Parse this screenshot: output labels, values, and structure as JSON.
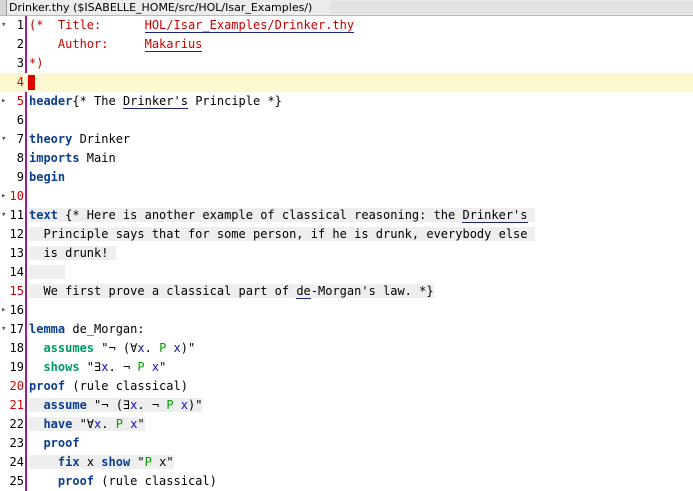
{
  "window": {
    "title": "Drinker.thy ($ISABELLE_HOME/src/HOL/Isar_Examples/)"
  },
  "editor": {
    "lines": [
      {
        "n": "1",
        "fold": "▾",
        "gutter_color": "black",
        "segs": [
          [
            "cm",
            "(*  Title:      "
          ],
          [
            "cmu",
            "HOL/Isar_Examples/Drinker.thy"
          ]
        ]
      },
      {
        "n": "2",
        "segs": [
          [
            "cm",
            "    Author:     "
          ],
          [
            "cmu",
            "Makarius"
          ]
        ]
      },
      {
        "n": "3",
        "segs": [
          [
            "cm",
            "*)"
          ]
        ]
      },
      {
        "n": "4",
        "gutter_color": "red",
        "current": true,
        "marker": true,
        "segs": []
      },
      {
        "n": "5",
        "fold": "▸",
        "gutter_color": "red",
        "segs": [
          [
            "kw",
            "header"
          ],
          [
            "",
            "{* The "
          ],
          [
            "u",
            "Drinker's"
          ],
          [
            "",
            " Principle *}"
          ]
        ]
      },
      {
        "n": "6",
        "segs": []
      },
      {
        "n": "7",
        "fold": "▾",
        "segs": [
          [
            "kw",
            "theory"
          ],
          [
            "",
            " Drinker"
          ]
        ]
      },
      {
        "n": "8",
        "segs": [
          [
            "kw",
            "imports"
          ],
          [
            "",
            " Main"
          ]
        ]
      },
      {
        "n": "9",
        "segs": [
          [
            "kw",
            "begin"
          ]
        ]
      },
      {
        "n": "10",
        "fold": "▸",
        "gutter_color": "red",
        "segs": []
      },
      {
        "n": "11",
        "fold": "▾",
        "hl": true,
        "segs": [
          [
            "kw",
            "text"
          ],
          [
            "",
            " {* Here is another example of classical reasoning: the "
          ],
          [
            "u",
            "Drinker's"
          ],
          [
            "",
            " "
          ]
        ]
      },
      {
        "n": "12",
        "hl": true,
        "segs": [
          [
            "",
            "  Principle says that for some person, if he is drunk, everybody else "
          ]
        ]
      },
      {
        "n": "13",
        "hl": true,
        "segs": [
          [
            "",
            "  is drunk! "
          ]
        ]
      },
      {
        "n": "14",
        "hl": true,
        "segs": [
          [
            "",
            "     "
          ]
        ]
      },
      {
        "n": "15",
        "gutter_color": "red",
        "hl": true,
        "segs": [
          [
            "",
            "  We first prove a classical part of "
          ],
          [
            "u",
            "de"
          ],
          [
            "",
            "-Morgan's law. *}"
          ]
        ]
      },
      {
        "n": "16",
        "fold": "▸",
        "segs": []
      },
      {
        "n": "17",
        "fold": "▾",
        "segs": [
          [
            "kw",
            "lemma"
          ],
          [
            "",
            " de_Morgan:"
          ]
        ]
      },
      {
        "n": "18",
        "segs": [
          [
            "",
            "  "
          ],
          [
            "kw2",
            "assumes"
          ],
          [
            "",
            " \"¬ (∀"
          ],
          [
            "bd",
            "x"
          ],
          [
            "",
            ". "
          ],
          [
            "fr",
            "P"
          ],
          [
            "",
            " "
          ],
          [
            "bd",
            "x"
          ],
          [
            "",
            ")\""
          ]
        ]
      },
      {
        "n": "19",
        "segs": [
          [
            "",
            "  "
          ],
          [
            "kw2",
            "shows"
          ],
          [
            "",
            " \"∃"
          ],
          [
            "bd",
            "x"
          ],
          [
            "",
            ". ¬ "
          ],
          [
            "fr",
            "P"
          ],
          [
            "",
            " "
          ],
          [
            "bd",
            "x"
          ],
          [
            "",
            "\""
          ]
        ]
      },
      {
        "n": "20",
        "gutter_color": "red",
        "segs": [
          [
            "kw",
            "proof"
          ],
          [
            "",
            " (rule classical)"
          ]
        ]
      },
      {
        "n": "21",
        "gutter_color": "red",
        "hl": true,
        "segs": [
          [
            "",
            "  "
          ],
          [
            "kw",
            "assume"
          ],
          [
            "",
            " \"¬ (∃"
          ],
          [
            "bd",
            "x"
          ],
          [
            "",
            ". ¬ "
          ],
          [
            "fr",
            "P"
          ],
          [
            "",
            " "
          ],
          [
            "bd",
            "x"
          ],
          [
            "",
            ")\""
          ]
        ]
      },
      {
        "n": "22",
        "hl": true,
        "segs": [
          [
            "",
            "  "
          ],
          [
            "kw",
            "have"
          ],
          [
            "",
            " \"∀"
          ],
          [
            "bd",
            "x"
          ],
          [
            "",
            ". "
          ],
          [
            "fr",
            "P"
          ],
          [
            "",
            " "
          ],
          [
            "bd",
            "x"
          ],
          [
            "",
            "\""
          ]
        ]
      },
      {
        "n": "23",
        "segs": [
          [
            "",
            "  "
          ],
          [
            "kw",
            "proof"
          ]
        ]
      },
      {
        "n": "24",
        "hl": true,
        "segs": [
          [
            "",
            "    "
          ],
          [
            "kw",
            "fix"
          ],
          [
            "",
            " x "
          ],
          [
            "kw",
            "show"
          ],
          [
            "",
            " \""
          ],
          [
            "fr",
            "P"
          ],
          [
            "",
            " x\""
          ]
        ]
      },
      {
        "n": "25",
        "segs": [
          [
            "",
            "    "
          ],
          [
            "kw",
            "proof"
          ],
          [
            "",
            " (rule classical)"
          ]
        ]
      }
    ]
  }
}
